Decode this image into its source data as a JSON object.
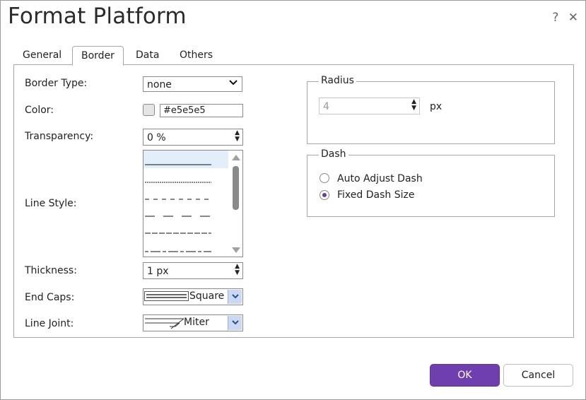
{
  "dialog": {
    "title": "Format Platform",
    "help": "?",
    "close": "✕"
  },
  "tabs": [
    {
      "label": "General"
    },
    {
      "label": "Border"
    },
    {
      "label": "Data"
    },
    {
      "label": "Others"
    }
  ],
  "border": {
    "type_label": "Border Type:",
    "type_value": "none",
    "color_label": "Color:",
    "color_value": "#e5e5e5",
    "transparency_label": "Transparency:",
    "transparency_value": "0 %",
    "line_style_label": "Line Style:",
    "thickness_label": "Thickness:",
    "thickness_value": "1 px",
    "end_caps_label": "End Caps:",
    "end_caps_value": "Square",
    "line_joint_label": "Line Joint:",
    "line_joint_value": "Miter"
  },
  "radius": {
    "legend": "Radius",
    "value": "4",
    "unit": "px"
  },
  "dash": {
    "legend": "Dash",
    "options": [
      {
        "label": "Auto Adjust Dash",
        "selected": false
      },
      {
        "label": "Fixed Dash Size",
        "selected": true
      }
    ]
  },
  "buttons": {
    "ok": "OK",
    "cancel": "Cancel"
  },
  "colors": {
    "accent": "#6f3fb0",
    "swatch": "#e5e5e5",
    "selected_row": "#e2effa"
  }
}
